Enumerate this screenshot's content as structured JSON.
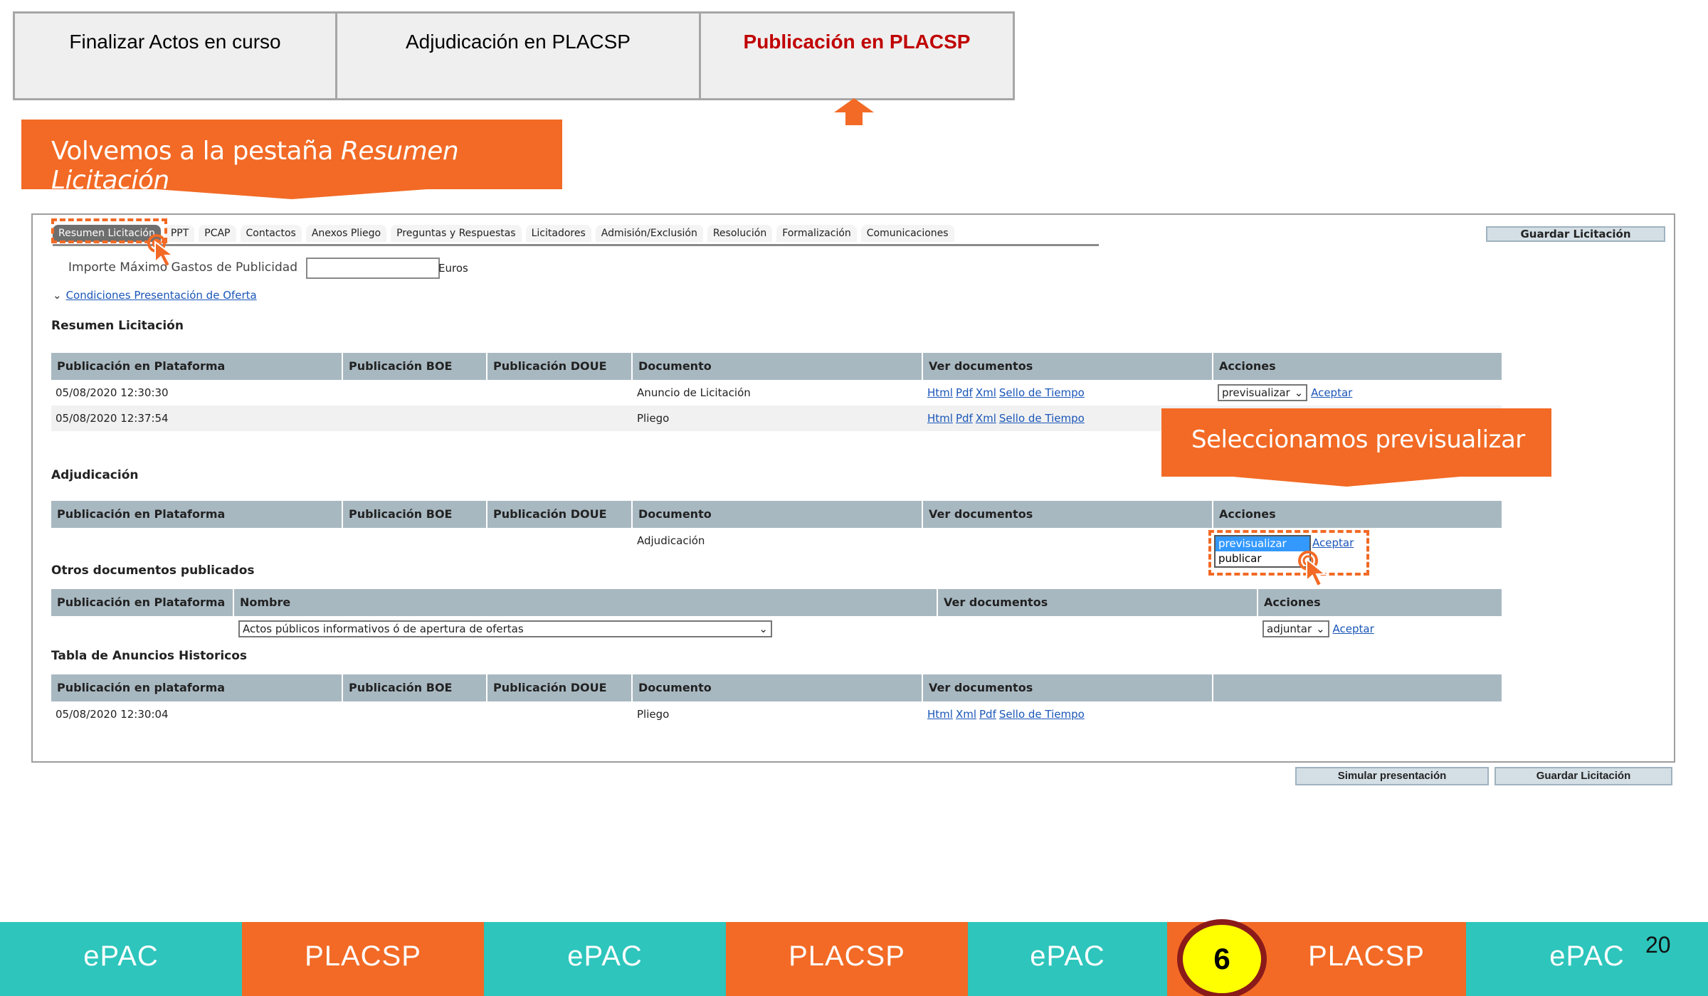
{
  "steps": [
    {
      "label": "Finalizar Actos en curso"
    },
    {
      "label": "Adjudicación en PLACSP"
    },
    {
      "label": "Publicación en PLACSP"
    }
  ],
  "callouts": {
    "back_prefix": "Volvemos a la pestaña ",
    "back_em": "Resumen Licitación",
    "select": "Seleccionamos previsualizar"
  },
  "tabs": [
    "Resumen Licitación",
    "PPT",
    "PCAP",
    "Contactos",
    "Anexos Pliego",
    "Preguntas y Respuestas",
    "Licitadores",
    "Admisión/Exclusión",
    "Resolución",
    "Formalización",
    "Comunicaciones"
  ],
  "toolbar": {
    "guardar": "Guardar Licitación"
  },
  "importe": {
    "label": "Importe Máximo Gastos de Publicidad",
    "value": "",
    "unit": "Euros"
  },
  "condiciones": "Condiciones Presentación de Oferta",
  "resumen": {
    "title": "Resumen Licitación",
    "headers": [
      "Publicación en Plataforma",
      "Publicación BOE",
      "Publicación DOUE",
      "Documento",
      "Ver documentos",
      "Acciones"
    ],
    "rows": [
      {
        "fecha": "05/08/2020 12:30:30",
        "boe": "",
        "doue": "",
        "documento": "Anuncio de Licitación",
        "links": [
          "Html",
          "Pdf",
          "Xml",
          "Sello de Tiempo"
        ],
        "accion": "previsualizar",
        "aceptar": "Aceptar"
      },
      {
        "fecha": "05/08/2020 12:37:54",
        "boe": "",
        "doue": "",
        "documento": "Pliego",
        "links": [
          "Html",
          "Pdf",
          "Xml",
          "Sello de Tiempo"
        ],
        "accion": "",
        "aceptar": ""
      }
    ]
  },
  "adjudicacion": {
    "title": "Adjudicación",
    "headers": [
      "Publicación en Plataforma",
      "Publicación BOE",
      "Publicación DOUE",
      "Documento",
      "Ver documentos",
      "Acciones"
    ],
    "row": {
      "documento": "Adjudicación"
    },
    "dropdown_options": [
      "previsualizar",
      "publicar"
    ],
    "aceptar": "Aceptar"
  },
  "otros": {
    "title": "Otros documentos publicados",
    "headers": [
      "Publicación en Plataforma",
      "Nombre",
      "Ver documentos",
      "Acciones"
    ],
    "row": {
      "nombre": "Actos públicos informativos ó de apertura de ofertas",
      "accion": "adjuntar",
      "aceptar": "Aceptar"
    }
  },
  "historicos": {
    "title": "Tabla de Anuncios Historicos",
    "headers": [
      "Publicación en plataforma",
      "Publicación BOE",
      "Publicación DOUE",
      "Documento",
      "Ver documentos",
      ""
    ],
    "row": {
      "fecha": "05/08/2020 12:30:04",
      "documento": "Pliego",
      "links": [
        "Html",
        "Xml",
        "Pdf",
        "Sello de Tiempo"
      ]
    }
  },
  "bottom_buttons": {
    "simular": "Simular presentación",
    "guardar": "Guardar Licitación"
  },
  "band": [
    {
      "label": "ePAC",
      "color": "#2dc5bc"
    },
    {
      "label": "PLACSP",
      "color": "#f26a25"
    },
    {
      "label": "ePAC",
      "color": "#2dc5bc"
    },
    {
      "label": "PLACSP",
      "color": "#f26a25"
    },
    {
      "label": "ePAC",
      "color": "#2dc5bc"
    },
    {
      "label": "PLACSP",
      "color": "#f26a25"
    },
    {
      "label": "ePAC",
      "color": "#2dc5bc"
    }
  ],
  "step_badge": "6",
  "page_number": "20",
  "icons": [
    "up-arrow-icon",
    "hand-cursor-icon",
    "chevron-down-icon"
  ],
  "colors": {
    "accent": "#f26a25",
    "teal": "#2dc5bc",
    "active_step": "#c00000",
    "table_header": "#a8b8c1"
  }
}
